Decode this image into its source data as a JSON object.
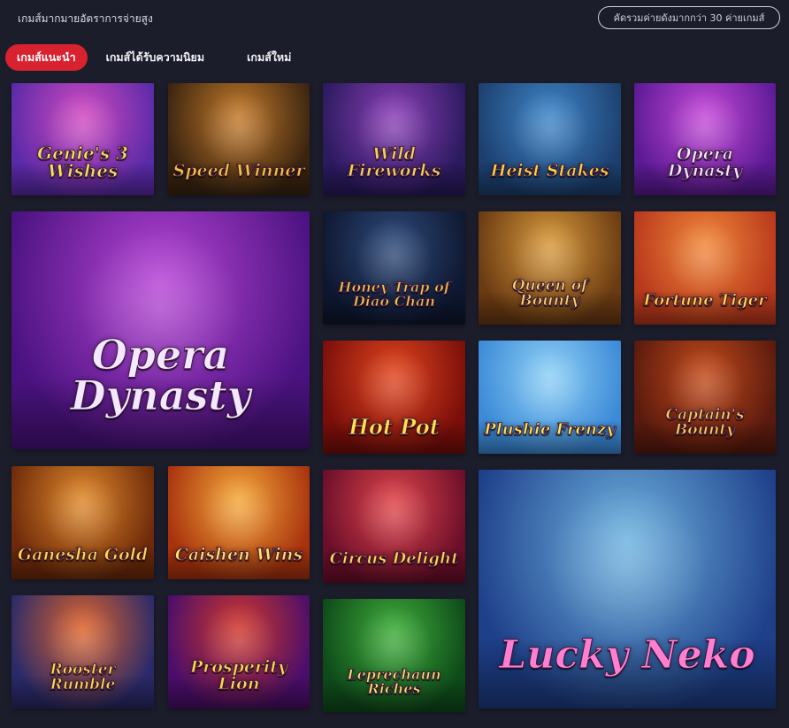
{
  "header": {
    "title": "เกมส์มากมายอัตราการจ่ายสูง",
    "provider_button": "คัดรวมค่ายดังมากกว่า 30 ค่ายเกมส์"
  },
  "tabs": [
    {
      "label": "เกมส์แนะนำ",
      "active": true
    },
    {
      "label": "เกมส์ได้รับความนิยม",
      "active": false
    },
    {
      "label": "เกมส์ใหม่",
      "active": false
    }
  ],
  "colors": {
    "accent": "#d8222f",
    "background": "#1c1d2b"
  },
  "games": [
    {
      "title": "Genie's 3 Wishes",
      "bg1": "#5a2aa8",
      "bg2": "#d24ac0",
      "text": "#f2e35a"
    },
    {
      "title": "Speed Winner",
      "bg1": "#3a2410",
      "bg2": "#c47a2a",
      "text": "#f3c239"
    },
    {
      "title": "Wild Fireworks",
      "bg1": "#2a1a5e",
      "bg2": "#8b3fb7",
      "text": "#f5d35a"
    },
    {
      "title": "Heist Stakes",
      "bg1": "#1c3f6e",
      "bg2": "#3f86c9",
      "text": "#ffd23f"
    },
    {
      "title": "Opera Dynasty",
      "bg1": "#5b1a93",
      "bg2": "#c64ad8",
      "text": "#f3e8ff"
    },
    {
      "title": "Opera Dynasty",
      "bg1": "#4a1280",
      "bg2": "#b845d6",
      "text": "#f3e8ff"
    },
    {
      "title": "Honey Trap of Diao Chan",
      "bg1": "#0e1730",
      "bg2": "#2e4a7a",
      "text": "#f0c548"
    },
    {
      "title": "Queen of Bounty",
      "bg1": "#6a3a12",
      "bg2": "#d89a3c",
      "text": "#f6d36a"
    },
    {
      "title": "Fortune Tiger",
      "bg1": "#b8381c",
      "bg2": "#f0883a",
      "text": "#ffd84a"
    },
    {
      "title": "Hot Pot",
      "bg1": "#7a0e0a",
      "bg2": "#e2461e",
      "text": "#ffe14a"
    },
    {
      "title": "Plushie Frenzy",
      "bg1": "#3c8ad8",
      "bg2": "#8ed0f5",
      "text": "#ffe94a"
    },
    {
      "title": "Captain's Bounty",
      "bg1": "#5a1a0e",
      "bg2": "#c24a1a",
      "text": "#f6cf55"
    },
    {
      "title": "Ganesha Gold",
      "bg1": "#6e2a0a",
      "bg2": "#e0892a",
      "text": "#ffd84a"
    },
    {
      "title": "Caishen Wins",
      "bg1": "#a8320e",
      "bg2": "#f5a93a",
      "text": "#ffe36a"
    },
    {
      "title": "Circus Delight",
      "bg1": "#6a0e2a",
      "bg2": "#e0454a",
      "text": "#ffd84a"
    },
    {
      "title": "Lucky Neko",
      "bg1": "#1e3f8a",
      "bg2": "#6fb4e0",
      "text": "#ff7fd0"
    },
    {
      "title": "Rooster Rumble",
      "bg1": "#2a2a6a",
      "bg2": "#e0642a",
      "text": "#ffd84a"
    },
    {
      "title": "Prosperity Lion",
      "bg1": "#4a0e6a",
      "bg2": "#d2382a",
      "text": "#ffd84a"
    },
    {
      "title": "Leprechaun Riches",
      "bg1": "#0e4a1a",
      "bg2": "#3fae3a",
      "text": "#ffe36a"
    }
  ]
}
